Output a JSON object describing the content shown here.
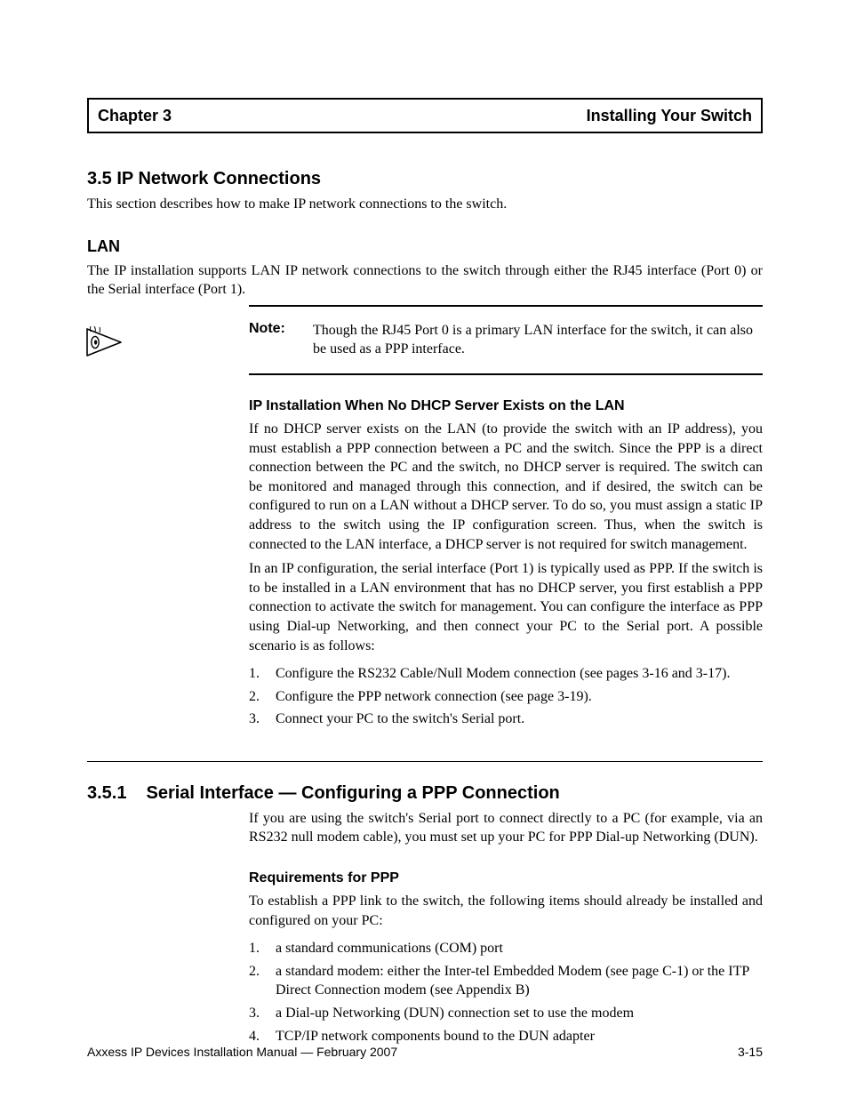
{
  "chapter": {
    "left": "Chapter 3",
    "right": "Installing Your Switch",
    "lead_title": "3.5  IP Network Connections",
    "lead_text": "This section describes how to make IP network connections to the switch."
  },
  "lan": {
    "title": "LAN",
    "para": "The IP installation supports LAN IP network connections to the switch through either the RJ45 interface (Port 0) or the Serial interface (Port 1).",
    "note_label": "Note:",
    "note_text": "Though the RJ45 Port 0 is a primary LAN interface for the switch, it can also be used as a PPP interface.",
    "after_title": "IP Installation When No DHCP Server Exists on the LAN",
    "after1": "If no DHCP server exists on the LAN (to provide the switch with an IP address), you must establish a PPP connection between a PC and the switch. Since the PPP is a direct connection between the PC and the switch, no DHCP server is required. The switch can be monitored and managed through this connection, and if desired, the switch can be configured to run on a LAN without a DHCP server. To do so, you must assign a static IP address to the switch using the IP configuration screen. Thus, when the switch is connected to the LAN interface, a DHCP server is not required for switch management.",
    "after2": "In an IP configuration, the serial interface (Port 1) is typically used as PPP. If the switch is to be installed in a LAN environment that has no DHCP server, you first establish a PPP connection to activate the switch for management. You can configure the interface as PPP using Dial-up Networking, and then connect your PC to the Serial port. A possible scenario is as follows:",
    "steps": [
      "Configure the RS232 Cable/Null Modem connection (see pages 3-16 and 3-17).",
      "Configure the PPP network connection (see page 3-19).",
      "Connect your PC to the switch's Serial port."
    ]
  },
  "sec3": {
    "num": "3.5.1",
    "title": "Serial Interface — Configuring a PPP Connection",
    "intro": "If you are using the switch's Serial port to connect directly to a PC (for example, via an RS232 null modem cable), you must set up your PC for PPP Dial-up Networking (DUN).",
    "req_title": "Requirements for PPP",
    "req_text": "To establish a PPP link to the switch, the following items should already be installed and configured on your PC:",
    "reqs": [
      "a standard communications (COM) port",
      "a standard modem: either the Inter-tel Embedded Modem (see page C-1) or the ITP Direct Connection modem (see Appendix B)",
      "a Dial-up Networking (DUN) connection set to use the modem",
      "TCP/IP network components bound to the DUN adapter"
    ]
  },
  "footer": {
    "left": "Axxess IP Devices Installation Manual — February 2007",
    "right": "3-15"
  }
}
